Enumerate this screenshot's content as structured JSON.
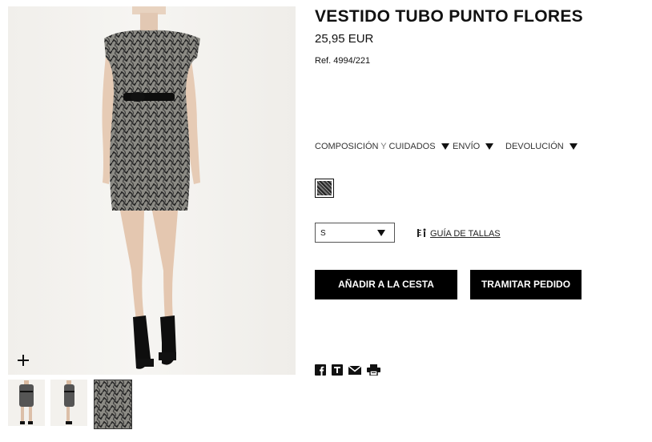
{
  "product": {
    "title": "VESTIDO TUBO PUNTO FLORES",
    "price": "25,95 EUR",
    "reference": "Ref. 4994/221"
  },
  "info_tabs": {
    "composition_a": "COMPOSICIÓN",
    "composition_y": " Y ",
    "composition_b": "CUIDADOS",
    "shipping": "ENVÍO",
    "returns": "DEVOLUCIÓN"
  },
  "colors": {
    "accent": "#000000",
    "dress_dark": "#2b2b2b",
    "dress_light": "#8a8a84"
  },
  "size_select": {
    "selected": "S"
  },
  "size_guide": {
    "label": "GUÍA DE TALLAS"
  },
  "actions": {
    "add_to_cart": "AÑADIR A LA CESTA",
    "checkout": "TRAMITAR PEDIDO"
  },
  "icons": {
    "zoom": "plus-icon",
    "size_guide": "ruler-icon",
    "share": [
      "facebook-icon",
      "tuenti-icon",
      "mail-icon",
      "print-icon"
    ]
  },
  "gallery": {
    "thumbnails": [
      "front-view",
      "side-view",
      "fabric-detail"
    ],
    "selected_index": 0
  }
}
